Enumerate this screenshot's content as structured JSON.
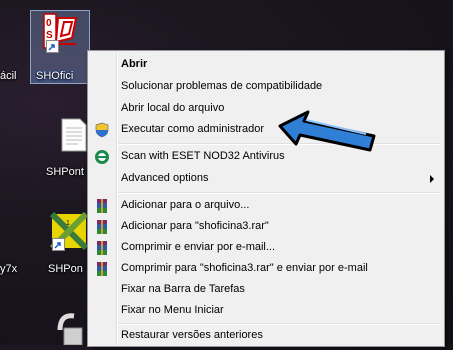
{
  "desktop": {
    "icons": [
      {
        "label": "ácil"
      },
      {
        "label": "SHOfici"
      },
      {
        "label": "SHPont"
      },
      {
        "label": "y7x"
      },
      {
        "label": "SHPon"
      }
    ]
  },
  "context_menu": {
    "items": [
      {
        "label": "Abrir",
        "icon": "",
        "bold": true
      },
      {
        "label": "Solucionar problemas de compatibilidade",
        "icon": ""
      },
      {
        "label": "Abrir local do arquivo",
        "icon": ""
      },
      {
        "label": "Executar como administrador",
        "icon": "uac-shield-icon"
      },
      {
        "label": "Scan with ESET NOD32 Antivirus",
        "icon": "eset-icon"
      },
      {
        "label": "Advanced options",
        "icon": "",
        "submenu": true
      },
      {
        "label": "Adicionar para o arquivo...",
        "icon": "winrar-icon"
      },
      {
        "label": "Adicionar para \"shoficina3.rar\"",
        "icon": "winrar-icon"
      },
      {
        "label": "Comprimir e enviar por e-mail...",
        "icon": "winrar-icon"
      },
      {
        "label": "Comprimir para \"shoficina3.rar\" e enviar por e-mail",
        "icon": "winrar-icon"
      },
      {
        "label": "Fixar na Barra de Tarefas",
        "icon": ""
      },
      {
        "label": "Fixar no Menu Iniciar",
        "icon": ""
      },
      {
        "label": "Restaurar versões anteriores",
        "icon": ""
      }
    ]
  },
  "colors": {
    "menu_bg": "#f0f0f0",
    "arrow_fill": "#2f7fd6",
    "arrow_outline": "#000000"
  }
}
